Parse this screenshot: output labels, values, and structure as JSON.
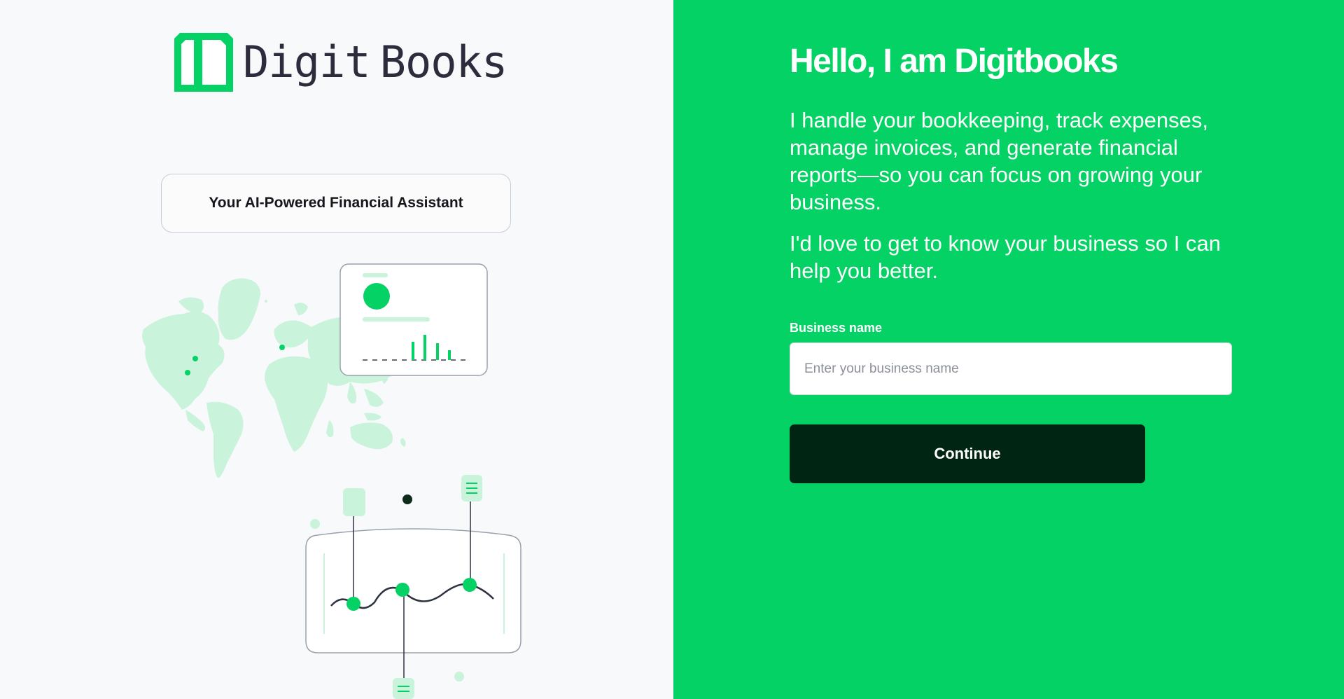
{
  "brand": {
    "name_part1": "Digit",
    "name_part2": "Books",
    "logo_color": "#05d264",
    "text_color": "#2c2c3d"
  },
  "tagline": "Your AI-Powered Financial Assistant",
  "onboarding": {
    "heading": "Hello, I am Digitbooks",
    "intro": "I handle your bookkeeping, track expenses, manage invoices, and generate financial reports—so you can focus on growing your business.",
    "intro2": "I'd love to get to know your business so I can help you better.",
    "business_name_label": "Business name",
    "business_name_placeholder": "Enter your business name",
    "business_name_value": "",
    "continue_label": "Continue"
  },
  "colors": {
    "accent": "#05d264",
    "button_bg": "#002513",
    "left_bg": "#f8f9fb"
  }
}
